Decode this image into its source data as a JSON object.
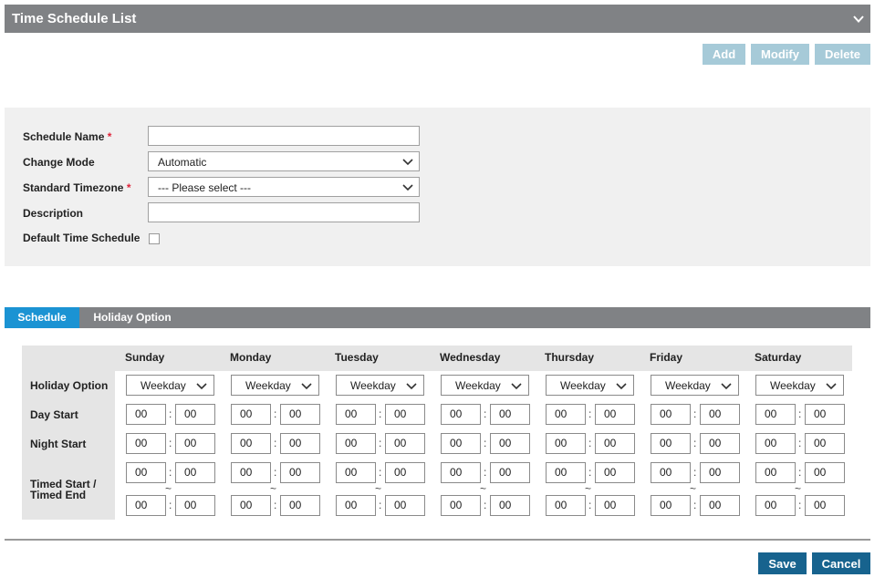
{
  "header": {
    "title": "Time Schedule List",
    "collapse_icon": "chevron-down-icon"
  },
  "toolbar": {
    "add": "Add",
    "modify": "Modify",
    "delete": "Delete"
  },
  "form": {
    "schedule_name": {
      "label": "Schedule Name",
      "required_mark": "*",
      "value": ""
    },
    "change_mode": {
      "label": "Change Mode",
      "value": "Automatic"
    },
    "standard_timezone": {
      "label": "Standard Timezone",
      "required_mark": "*",
      "value": "--- Please select ---"
    },
    "description": {
      "label": "Description",
      "value": ""
    },
    "default_time_schedule": {
      "label": "Default Time Schedule",
      "checked": false
    }
  },
  "tabs": [
    {
      "label": "Schedule",
      "active": true
    },
    {
      "label": "Holiday Option",
      "active": false
    }
  ],
  "schedule": {
    "row_labels": {
      "holiday_option": "Holiday Option",
      "day_start": "Day Start",
      "night_start": "Night Start",
      "timed": "Timed Start / Timed End"
    },
    "colon": ":",
    "tilde": "~",
    "days": [
      {
        "name": "Sunday",
        "holiday": "Weekday",
        "day_h": "00",
        "day_m": "00",
        "night_h": "00",
        "night_m": "00",
        "ts_h": "00",
        "ts_m": "00",
        "te_h": "00",
        "te_m": "00"
      },
      {
        "name": "Monday",
        "holiday": "Weekday",
        "day_h": "00",
        "day_m": "00",
        "night_h": "00",
        "night_m": "00",
        "ts_h": "00",
        "ts_m": "00",
        "te_h": "00",
        "te_m": "00"
      },
      {
        "name": "Tuesday",
        "holiday": "Weekday",
        "day_h": "00",
        "day_m": "00",
        "night_h": "00",
        "night_m": "00",
        "ts_h": "00",
        "ts_m": "00",
        "te_h": "00",
        "te_m": "00"
      },
      {
        "name": "Wednesday",
        "holiday": "Weekday",
        "day_h": "00",
        "day_m": "00",
        "night_h": "00",
        "night_m": "00",
        "ts_h": "00",
        "ts_m": "00",
        "te_h": "00",
        "te_m": "00"
      },
      {
        "name": "Thursday",
        "holiday": "Weekday",
        "day_h": "00",
        "day_m": "00",
        "night_h": "00",
        "night_m": "00",
        "ts_h": "00",
        "ts_m": "00",
        "te_h": "00",
        "te_m": "00"
      },
      {
        "name": "Friday",
        "holiday": "Weekday",
        "day_h": "00",
        "day_m": "00",
        "night_h": "00",
        "night_m": "00",
        "ts_h": "00",
        "ts_m": "00",
        "te_h": "00",
        "te_m": "00"
      },
      {
        "name": "Saturday",
        "holiday": "Weekday",
        "day_h": "00",
        "day_m": "00",
        "night_h": "00",
        "night_m": "00",
        "ts_h": "00",
        "ts_m": "00",
        "te_h": "00",
        "te_m": "00"
      }
    ]
  },
  "footer": {
    "save": "Save",
    "cancel": "Cancel"
  },
  "colors": {
    "header_bg": "#808285",
    "tab_active": "#1b93d3",
    "button_light": "#a6cad8",
    "button_dark": "#17638e",
    "required": "#e0253b",
    "panel_bg": "#f0f0f0"
  }
}
